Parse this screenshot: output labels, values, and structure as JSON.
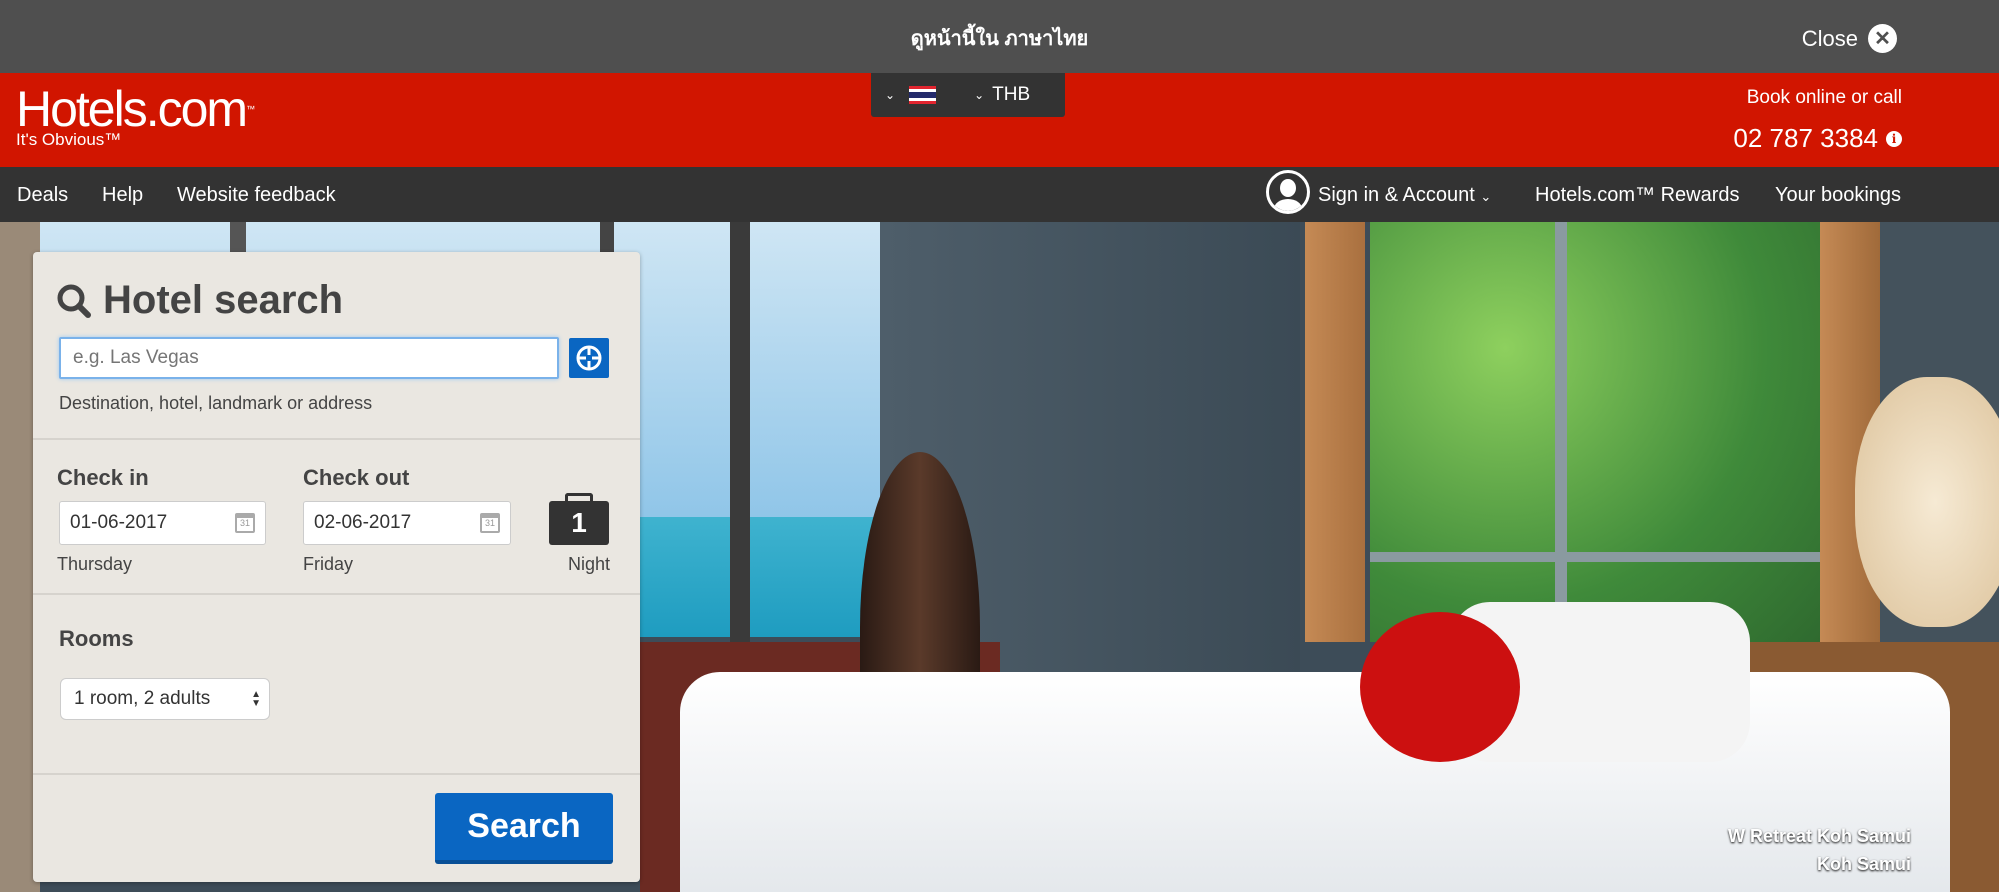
{
  "language_bar": {
    "message": "ดูหน้านี้ใน ภาษาไทย",
    "close_label": "Close"
  },
  "header": {
    "logo": "Hotels.com",
    "logo_tm": "™",
    "tagline": "It's Obvious™",
    "currency": "THB",
    "book_label": "Book online or call",
    "phone": "02 787 3384",
    "brand_color": "#d11500"
  },
  "nav": {
    "left": [
      "Deals",
      "Help",
      "Website feedback"
    ],
    "account": "Sign in & Account",
    "rewards": "Hotels.com™ Rewards",
    "bookings": "Your bookings"
  },
  "search": {
    "title": "Hotel search",
    "destination_placeholder": "e.g. Las Vegas",
    "destination_value": "",
    "destination_help": "Destination, hotel, landmark or address",
    "checkin_label": "Check in",
    "checkin_value": "01-06-2017",
    "checkin_day": "Thursday",
    "checkout_label": "Check out",
    "checkout_value": "02-06-2017",
    "checkout_day": "Friday",
    "nights": "1",
    "nights_label": "Night",
    "rooms_label": "Rooms",
    "rooms_value": "1 room, 2 adults",
    "search_button": "Search",
    "button_color": "#0a66c2"
  },
  "hero": {
    "caption_line1": "W Retreat Koh Samui",
    "caption_line2": "Koh Samui"
  }
}
